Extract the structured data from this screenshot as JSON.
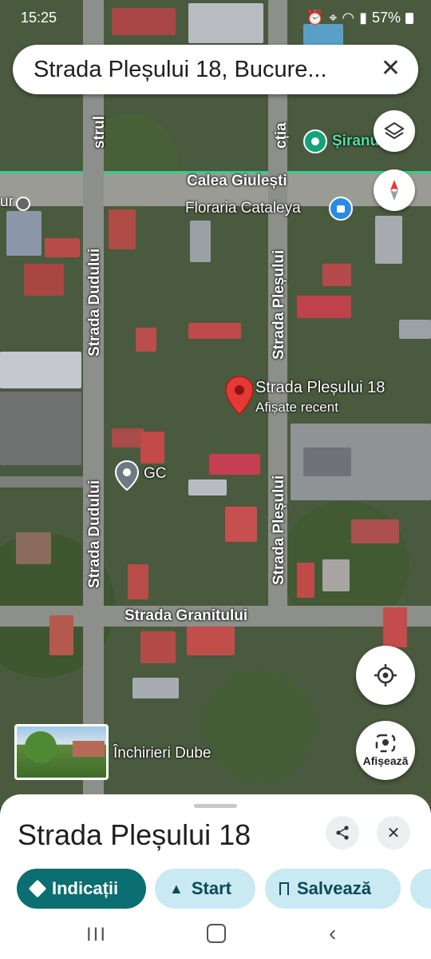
{
  "status": {
    "time": "15:25",
    "battery": "57%"
  },
  "search": {
    "query": "Strada Pleșului 18, Bucure..."
  },
  "map": {
    "roads": {
      "calea_giulesti": "Calea Giulești",
      "dudului_top": "Strada Dudului",
      "dudului_bottom": "Strada Dudului",
      "plesului_top": "Strada Pleșului",
      "plesului_bottom": "Strada Pleșului",
      "granitului": "Strada Granitului",
      "top_left_street": "strul",
      "top_right_street": "cția"
    },
    "pois": {
      "floraria": "Floraria Cataleya",
      "stranulue": "Șiranulue",
      "left_edge": "ur",
      "gc": "GC",
      "dube": "Închirieri Dube"
    },
    "pin": {
      "title": "Strada Pleșului 18",
      "subtitle": "Afișate recent"
    },
    "photo_button": "Afișează"
  },
  "sheet": {
    "title": "Strada Pleșului 18",
    "chips": {
      "directions": "Indicații",
      "start": "Start",
      "save": "Salvează"
    }
  },
  "colors": {
    "accent": "#0b6e70",
    "chip_bg": "#c9eaf2",
    "pin": "#e53935",
    "poi_teal": "#13a37a",
    "poi_blue": "#2a8ae6"
  }
}
